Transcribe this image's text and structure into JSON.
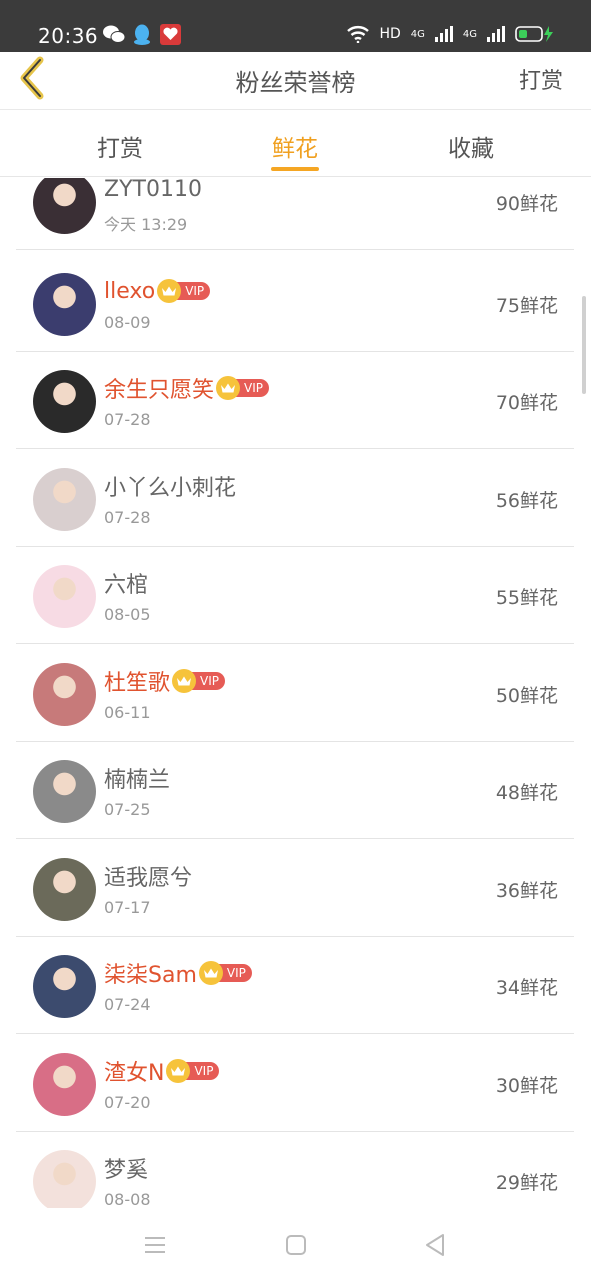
{
  "status": {
    "time": "20:36",
    "network": "HD",
    "signal1": "4G",
    "signal2": "4G"
  },
  "nav": {
    "title": "粉丝荣誉榜",
    "action": "打赏"
  },
  "tabs": [
    {
      "label": "打赏"
    },
    {
      "label": "鲜花"
    },
    {
      "label": "收藏"
    }
  ],
  "vip_label": "VIP",
  "rows": [
    {
      "name": "ZYT0110",
      "date": "今天 13:29",
      "count": "90鲜花",
      "vip": false,
      "avatar_color": "#3a2f35"
    },
    {
      "name": "llexo",
      "date": "08-09",
      "count": "75鲜花",
      "vip": true,
      "avatar_color": "#3b3d6e"
    },
    {
      "name": "余生只愿笑",
      "date": "07-28",
      "count": "70鲜花",
      "vip": true,
      "avatar_color": "#2a2a2a"
    },
    {
      "name": "小丫么小刺花",
      "date": "07-28",
      "count": "56鲜花",
      "vip": false,
      "avatar_color": "#d9cfcf"
    },
    {
      "name": "六棺",
      "date": "08-05",
      "count": "55鲜花",
      "vip": false,
      "avatar_color": "#f7dbe4"
    },
    {
      "name": "杜笙歌",
      "date": "06-11",
      "count": "50鲜花",
      "vip": true,
      "avatar_color": "#c77a7a"
    },
    {
      "name": "楠楠兰",
      "date": "07-25",
      "count": "48鲜花",
      "vip": false,
      "avatar_color": "#8a8a8a"
    },
    {
      "name": "适我愿兮",
      "date": "07-17",
      "count": "36鲜花",
      "vip": false,
      "avatar_color": "#6b6a5a"
    },
    {
      "name": "柒柒Sam",
      "date": "07-24",
      "count": "34鲜花",
      "vip": true,
      "avatar_color": "#3c4b6e"
    },
    {
      "name": "渣女N",
      "date": "07-20",
      "count": "30鲜花",
      "vip": true,
      "avatar_color": "#d86e86"
    },
    {
      "name": "梦奚",
      "date": "08-08",
      "count": "29鲜花",
      "vip": false,
      "avatar_color": "#f3e1dc"
    }
  ]
}
